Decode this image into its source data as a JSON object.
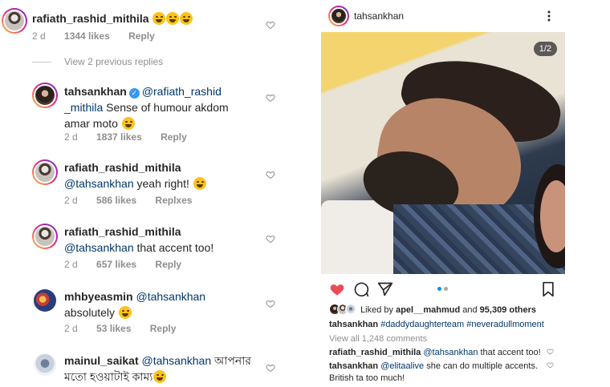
{
  "left_comments": {
    "main": {
      "user": "rafiath_rashid_mithila",
      "emojis": [
        "laughing",
        "laughing",
        "laughing"
      ],
      "time": "2 d",
      "likes": "1344 likes",
      "reply": "Reply"
    },
    "view_replies": "View 2 previous replies",
    "replies": [
      {
        "user": "tahsankhan",
        "verified": true,
        "mention": "@rafiath_rashid",
        "mention2": "_mithila",
        "text_line1": " Sense of humour akdom",
        "text_line2": "amar moto",
        "emoji": "laughing",
        "time": "2 d",
        "likes": "1837 likes",
        "reply": "Reply"
      },
      {
        "user": "rafiath_rashid_mithila",
        "mention": "@tahsankhan",
        "text": " yeah right!",
        "emoji": "eye-roll",
        "time": "2 d",
        "likes": "586 likes",
        "reply": "Replxes"
      },
      {
        "user": "rafiath_rashid_mithila",
        "mention": "@tahsankhan",
        "text": " that accent too!",
        "time": "2 d",
        "likes": "657 likes",
        "reply": "Reply"
      },
      {
        "user": "mhbyeasmin",
        "mention": "@tahsankhan",
        "text": "absolutely",
        "emoji": "heart-eyes",
        "time": "2 d",
        "likes": "53 likes",
        "reply": "Reply"
      },
      {
        "user": "mainul_saikat",
        "mention": "@tahsankhan",
        "text_line1": " আপনার",
        "text_line2": "মতো হওয়াটাই কাম্য",
        "emoji": "blush"
      }
    ]
  },
  "post": {
    "author": "tahsankhan",
    "counter": "1/2",
    "liked_by_prefix": "Liked by ",
    "liked_by_user": "apel__mahmud",
    "liked_by_and": " and ",
    "liked_by_others": "95,309 others",
    "caption_user": "tahsankhan",
    "caption_tags": " #daddydaughterteam #neveradullmoment",
    "view_all": "View all 1,248 comments",
    "comments": [
      {
        "user": "rafiath_rashid_mithila",
        "mention": " @tahsankhan",
        "text": " that accent too!"
      },
      {
        "user": "tahsankhan",
        "mention": " @elitaalive",
        "text": " she can do multiple accents.",
        "text2": "British ta too much!"
      }
    ],
    "colors": {
      "like_red": "#ed4956",
      "mention_blue": "#00376b",
      "verified_blue": "#3897f0",
      "dot_blue": "#0095f6"
    }
  }
}
